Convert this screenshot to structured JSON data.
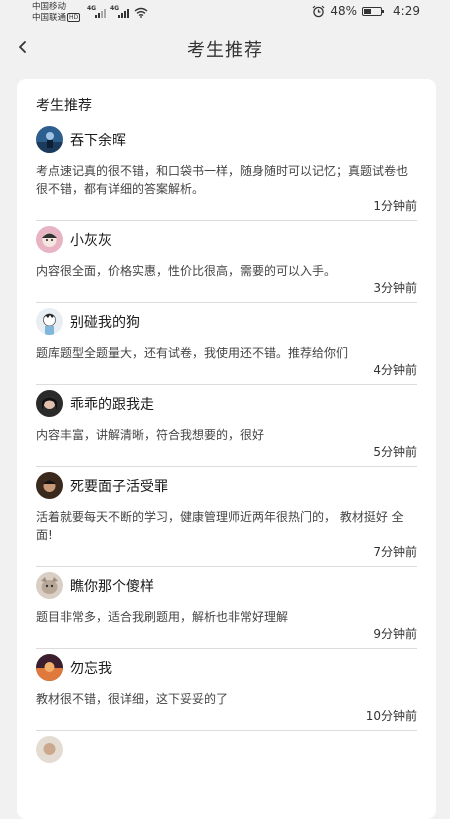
{
  "status_bar": {
    "carrier1": "中国移动",
    "carrier2": "中国联通",
    "hd": "HD",
    "net1": "4G",
    "net2": "4G",
    "battery": "48%",
    "time": "4:29",
    "battery_level": 0.48
  },
  "nav": {
    "title": "考生推荐"
  },
  "card": {
    "title": "考生推荐"
  },
  "reviews": [
    {
      "name": "吞下余晖",
      "text": "考点速记真的很不错，和口袋书一样，随身随时可以记忆；真题试卷也很不错，都有详细的答案解析。",
      "time": "1分钟前"
    },
    {
      "name": "小灰灰",
      "text": "内容很全面，价格实惠，性价比很高，需要的可以入手。",
      "time": "3分钟前"
    },
    {
      "name": "别碰我的狗",
      "text": "题库题型全题量大，还有试卷，我使用还不错。推荐给你们",
      "time": "4分钟前"
    },
    {
      "name": "乖乖的跟我走",
      "text": "内容丰富，讲解清晰，符合我想要的，很好",
      "time": "5分钟前"
    },
    {
      "name": "死要面子活受罪",
      "text": "活着就要每天不断的学习，健康管理师近两年很热门的， 教材挺好 全面!",
      "time": "7分钟前"
    },
    {
      "name": "瞧你那个傻样",
      "text": "题目非常多，适合我刷题用，解析也非常好理解",
      "time": "9分钟前"
    },
    {
      "name": "勿忘我",
      "text": "教材很不错，很详细，这下妥妥的了",
      "time": "10分钟前"
    }
  ]
}
